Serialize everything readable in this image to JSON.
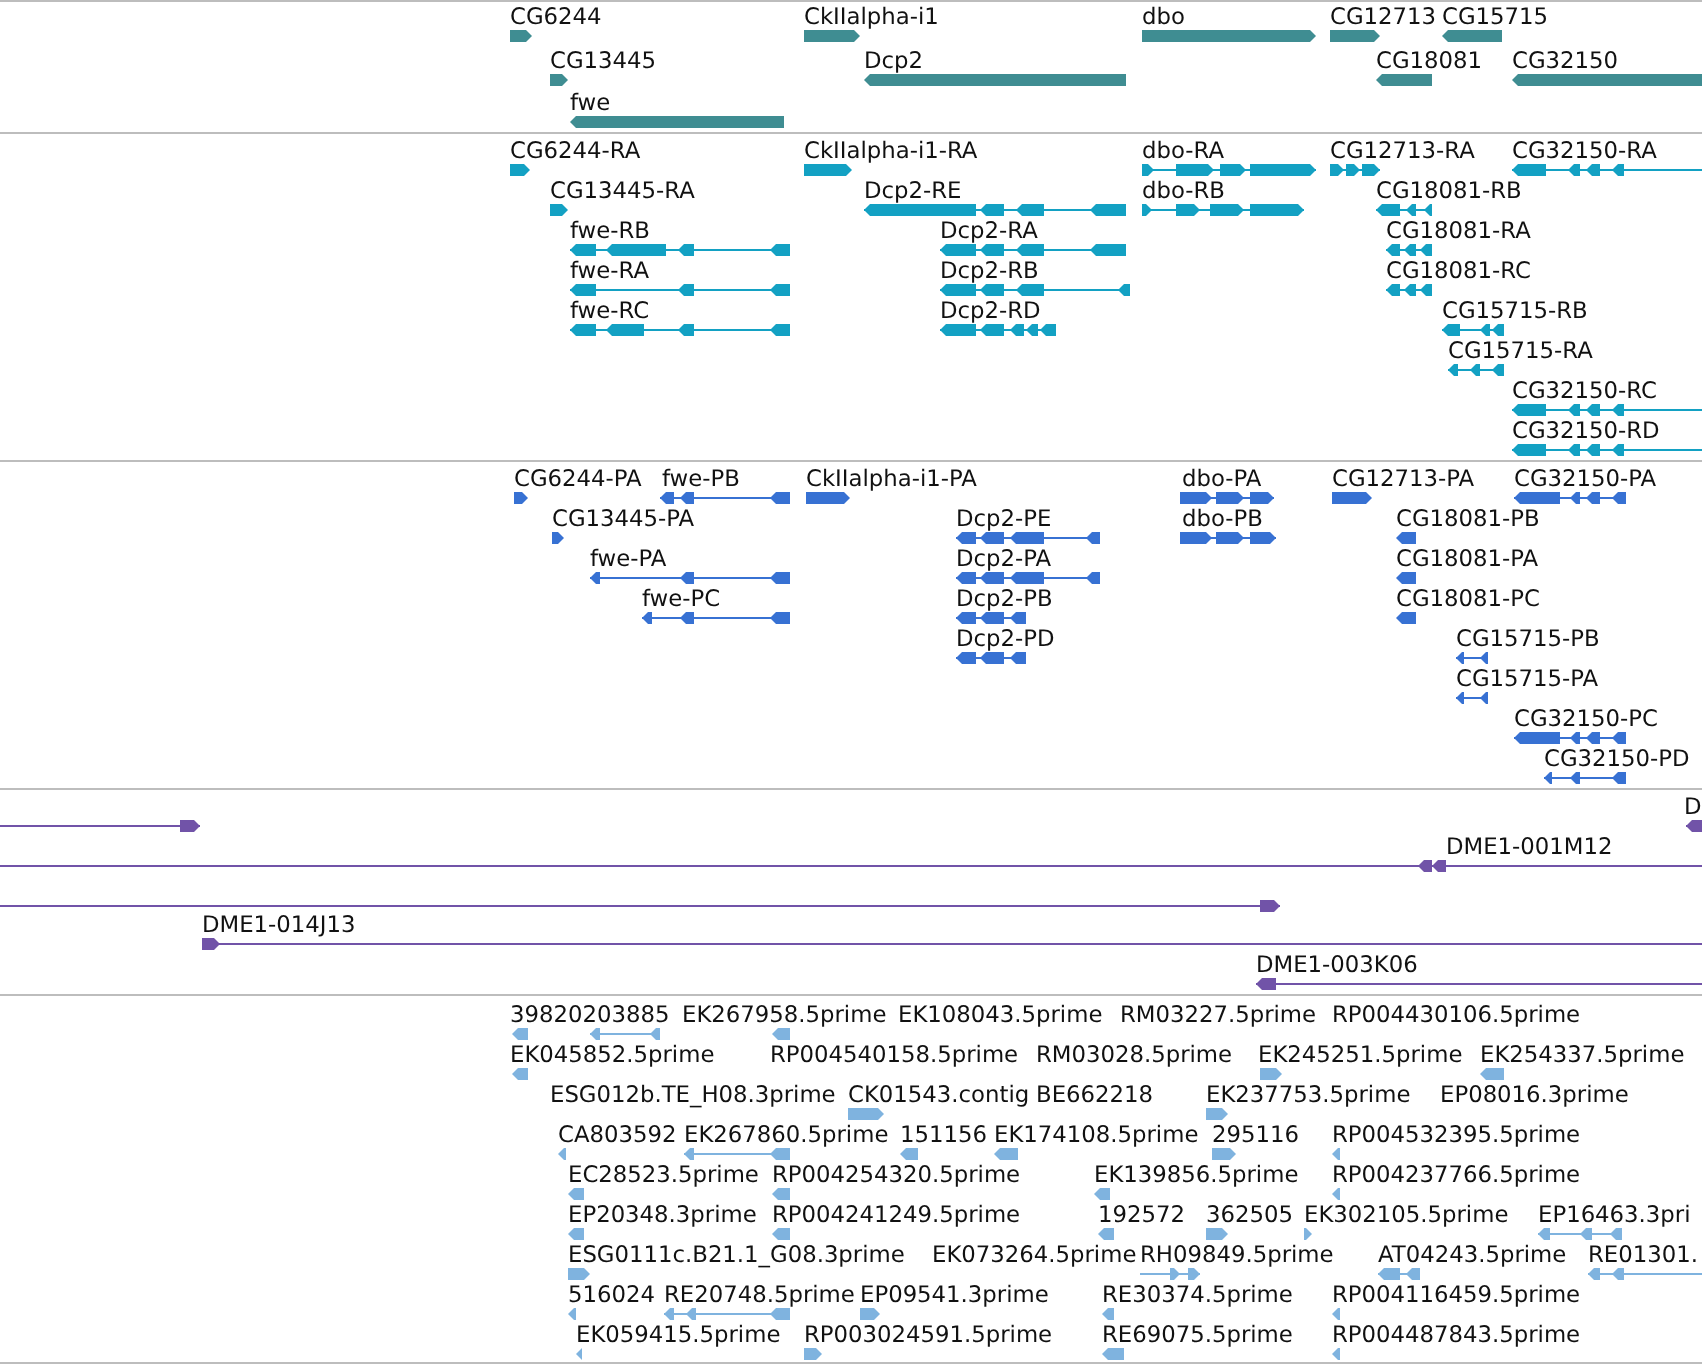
{
  "tracks": [
    {
      "kind": "gene",
      "features": [
        {
          "label": "CG6244",
          "reverse_strand": false
        },
        {
          "label": "CkIIalpha-i1",
          "reverse_strand": false
        },
        {
          "label": "dbo",
          "reverse_strand": false
        },
        {
          "label": "CG12713",
          "reverse_strand": false
        },
        {
          "label": "CG15715",
          "reverse_strand": true
        },
        {
          "label": "CG13445",
          "reverse_strand": false
        },
        {
          "label": "Dcp2",
          "reverse_strand": true
        },
        {
          "label": "CG18081",
          "reverse_strand": true
        },
        {
          "label": "CG32150",
          "reverse_strand": true
        },
        {
          "label": "fwe",
          "reverse_strand": true
        }
      ]
    },
    {
      "kind": "transcript",
      "features": [
        {
          "label": "CG6244-RA",
          "reverse_strand": false
        },
        {
          "label": "CkIIalpha-i1-RA",
          "reverse_strand": false
        },
        {
          "label": "dbo-RA",
          "reverse_strand": false
        },
        {
          "label": "CG12713-RA",
          "reverse_strand": false
        },
        {
          "label": "CG32150-RA",
          "reverse_strand": true
        },
        {
          "label": "CG13445-RA",
          "reverse_strand": false
        },
        {
          "label": "Dcp2-RE",
          "reverse_strand": true
        },
        {
          "label": "dbo-RB",
          "reverse_strand": false
        },
        {
          "label": "CG18081-RB",
          "reverse_strand": true
        },
        {
          "label": "fwe-RB",
          "reverse_strand": true
        },
        {
          "label": "Dcp2-RA",
          "reverse_strand": true
        },
        {
          "label": "CG18081-RA",
          "reverse_strand": true
        },
        {
          "label": "fwe-RA",
          "reverse_strand": true
        },
        {
          "label": "Dcp2-RB",
          "reverse_strand": true
        },
        {
          "label": "CG18081-RC",
          "reverse_strand": true
        },
        {
          "label": "fwe-RC",
          "reverse_strand": true
        },
        {
          "label": "Dcp2-RD",
          "reverse_strand": true
        },
        {
          "label": "CG15715-RB",
          "reverse_strand": true
        },
        {
          "label": "CG15715-RA",
          "reverse_strand": true
        },
        {
          "label": "CG32150-RC",
          "reverse_strand": true
        },
        {
          "label": "CG32150-RD",
          "reverse_strand": true
        }
      ]
    },
    {
      "kind": "protein",
      "features": [
        {
          "label": "CG6244-PA",
          "reverse_strand": false
        },
        {
          "label": "fwe-PB",
          "reverse_strand": true
        },
        {
          "label": "CkIIalpha-i1-PA",
          "reverse_strand": false
        },
        {
          "label": "dbo-PA",
          "reverse_strand": false
        },
        {
          "label": "CG12713-PA",
          "reverse_strand": false
        },
        {
          "label": "CG32150-PA",
          "reverse_strand": true
        },
        {
          "label": "CG13445-PA",
          "reverse_strand": false
        },
        {
          "label": "Dcp2-PE",
          "reverse_strand": true
        },
        {
          "label": "dbo-PB",
          "reverse_strand": false
        },
        {
          "label": "CG18081-PB",
          "reverse_strand": true
        },
        {
          "label": "fwe-PA",
          "reverse_strand": true
        },
        {
          "label": "Dcp2-PA",
          "reverse_strand": true
        },
        {
          "label": "CG18081-PA",
          "reverse_strand": true
        },
        {
          "label": "fwe-PC",
          "reverse_strand": true
        },
        {
          "label": "Dcp2-PB",
          "reverse_strand": true
        },
        {
          "label": "CG18081-PC",
          "reverse_strand": true
        },
        {
          "label": "Dcp2-PD",
          "reverse_strand": true
        },
        {
          "label": "CG15715-PB",
          "reverse_strand": true
        },
        {
          "label": "CG15715-PA",
          "reverse_strand": true
        },
        {
          "label": "CG32150-PC",
          "reverse_strand": true
        },
        {
          "label": "CG32150-PD",
          "reverse_strand": true
        }
      ]
    },
    {
      "kind": "clone",
      "features": [
        {
          "reverse_strand": false
        },
        {
          "label": "D",
          "reverse_strand": true
        },
        {
          "reverse_strand": true
        },
        {
          "label": "DME1-001M12",
          "reverse_strand": true
        },
        {
          "reverse_strand": false
        },
        {
          "label": "DME1-014J13",
          "reverse_strand": false
        },
        {
          "label": "DME1-003K06",
          "reverse_strand": true
        }
      ]
    },
    {
      "kind": "est",
      "features": [
        {
          "label": "39820203885",
          "reverse_strand": true
        },
        {
          "reverse_strand": true
        },
        {
          "label": "EK267958.5prime",
          "reverse_strand": true
        },
        {
          "label": "EK108043.5prime"
        },
        {
          "label": "RM03227.5prime"
        },
        {
          "label": "RP004430106.5prime"
        },
        {
          "label": "EK045852.5prime",
          "reverse_strand": true
        },
        {
          "label": "RP004540158.5prime"
        },
        {
          "label": "RM03028.5prime"
        },
        {
          "label": "EK245251.5prime",
          "reverse_strand": false
        },
        {
          "label": "EK254337.5prime",
          "reverse_strand": true
        },
        {
          "label": "ESG012b.TE_H08.3prime"
        },
        {
          "label": "CK01543.contig",
          "reverse_strand": false
        },
        {
          "label": "BE662218"
        },
        {
          "label": "EK237753.5prime",
          "reverse_strand": false
        },
        {
          "label": "EP08016.3prime"
        },
        {
          "label": "CA803592",
          "reverse_strand": true
        },
        {
          "label": "EK267860.5prime",
          "reverse_strand": true
        },
        {
          "label": "151156",
          "reverse_strand": true
        },
        {
          "label": "EK174108.5prime",
          "reverse_strand": true
        },
        {
          "label": "295116",
          "reverse_strand": false
        },
        {
          "label": "RP004532395.5prime",
          "reverse_strand": true
        },
        {
          "label": "EC28523.5prime",
          "reverse_strand": true
        },
        {
          "label": "RP004254320.5prime",
          "reverse_strand": true
        },
        {
          "label": "EK139856.5prime",
          "reverse_strand": true
        },
        {
          "label": "RP004237766.5prime",
          "reverse_strand": true
        },
        {
          "label": "EP20348.3prime",
          "reverse_strand": true
        },
        {
          "label": "RP004241249.5prime",
          "reverse_strand": true
        },
        {
          "label": "192572",
          "reverse_strand": true
        },
        {
          "label": "362505",
          "reverse_strand": false
        },
        {
          "label": "EK302105.5prime",
          "reverse_strand": false
        },
        {
          "label": "EP16463.3pri",
          "reverse_strand": true
        },
        {
          "label": "ESG0111c.B21.1_G08.3prime",
          "reverse_strand": false
        },
        {
          "label": "EK073264.5prime"
        },
        {
          "label": "RH09849.5prime",
          "reverse_strand": false
        },
        {
          "label": "AT04243.5prime",
          "reverse_strand": true
        },
        {
          "label": "RE01301.",
          "reverse_strand": true
        },
        {
          "label": "516024",
          "reverse_strand": true
        },
        {
          "label": "RE20748.5prime",
          "reverse_strand": true
        },
        {
          "label": "EP09541.3prime",
          "reverse_strand": false
        },
        {
          "label": "RE30374.5prime",
          "reverse_strand": true
        },
        {
          "label": "RP004116459.5prime",
          "reverse_strand": true
        },
        {
          "label": "EK059415.5prime",
          "reverse_strand": true
        },
        {
          "label": "RP003024591.5prime",
          "reverse_strand": false
        },
        {
          "label": "RE69075.5prime",
          "reverse_strand": true
        },
        {
          "label": "RP004487843.5prime",
          "reverse_strand": true
        }
      ]
    }
  ]
}
